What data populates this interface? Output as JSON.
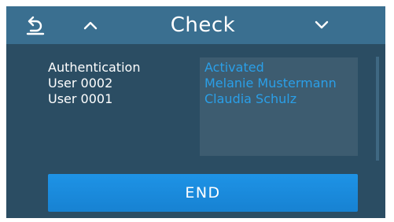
{
  "header": {
    "title": "Check",
    "back_icon": "back-arrow-icon",
    "up_icon": "chevron-up-icon",
    "down_icon": "chevron-down-icon"
  },
  "labels": [
    "Authentication",
    "User 0002",
    "User 0001"
  ],
  "values": [
    "Activated",
    "Melanie Mustermann",
    "Claudia Schulz"
  ],
  "end_button": {
    "label": "END"
  },
  "colors": {
    "background": "#2b4d63",
    "header": "#3a6f90",
    "value_box": "#3d5c70",
    "value_text": "#2a9fe8",
    "button": "#1e93e6"
  }
}
